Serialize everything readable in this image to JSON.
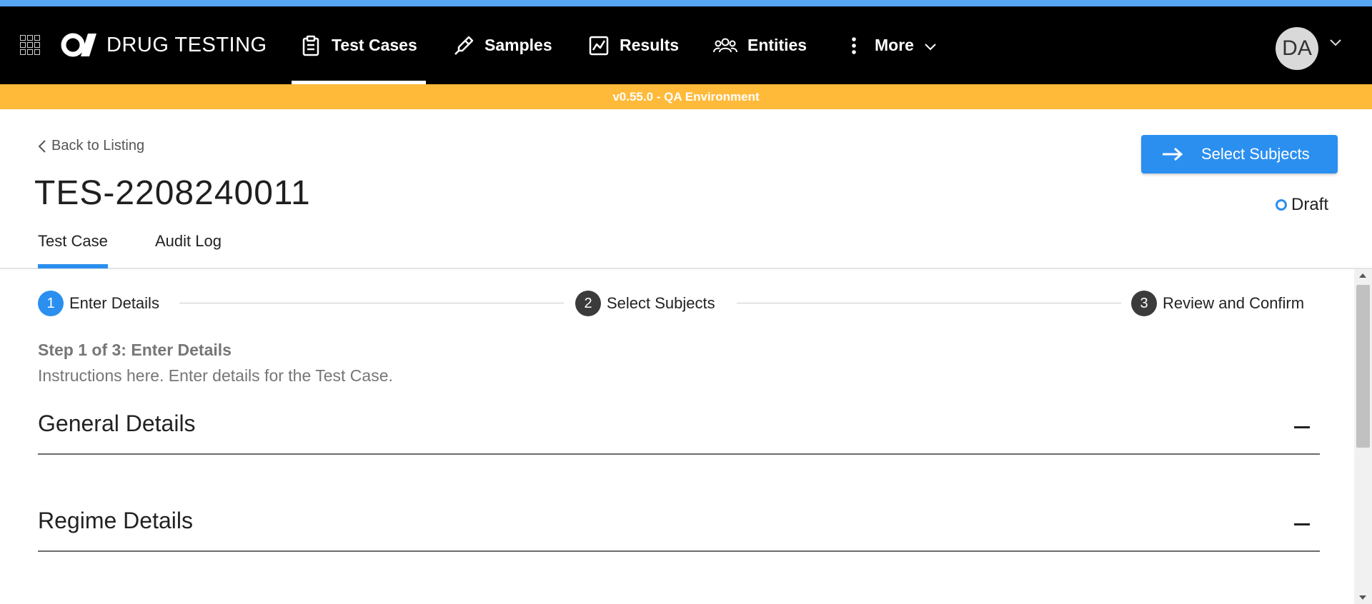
{
  "app": {
    "brand": "DRUG TESTING",
    "env_banner": "v0.55.0 - QA Environment"
  },
  "nav": {
    "items": [
      {
        "label": "Test Cases",
        "icon": "clipboard-icon",
        "active": true
      },
      {
        "label": "Samples",
        "icon": "dropper-icon",
        "active": false
      },
      {
        "label": "Results",
        "icon": "chart-line-icon",
        "active": false
      },
      {
        "label": "Entities",
        "icon": "people-icon",
        "active": false
      },
      {
        "label": "More",
        "icon": "kebab-icon",
        "active": false
      }
    ],
    "user_initials": "DA"
  },
  "header": {
    "back_label": "Back to Listing",
    "title": "TES-2208240011",
    "tabs": [
      {
        "label": "Test Case",
        "active": true
      },
      {
        "label": "Audit Log",
        "active": false
      }
    ],
    "primary_action": "Select Subjects",
    "status": "Draft"
  },
  "stepper": {
    "steps": [
      {
        "number": "1",
        "label": "Enter Details",
        "active": true
      },
      {
        "number": "2",
        "label": "Select Subjects",
        "active": false
      },
      {
        "number": "3",
        "label": "Review and Confirm",
        "active": false
      }
    ]
  },
  "step_info": {
    "title": "Step 1 of 3: Enter Details",
    "description": "Instructions here. Enter details for the Test Case."
  },
  "sections": [
    {
      "title": "General Details"
    },
    {
      "title": "Regime Details"
    }
  ],
  "colors": {
    "accent": "#2b8ff0",
    "env_banner": "#ffba3a",
    "top_stripe": "#55a5f2",
    "navbar": "#000000"
  }
}
